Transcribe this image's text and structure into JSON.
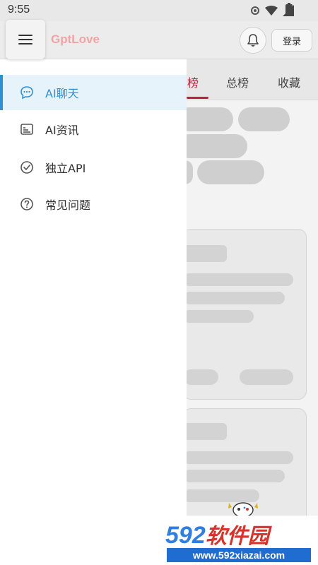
{
  "status_bar": {
    "time": "9:55"
  },
  "header": {
    "app_title": "GptLove",
    "login_label": "登录"
  },
  "tabs": [
    {
      "label": "榜",
      "active": true
    },
    {
      "label": "总榜",
      "active": false
    },
    {
      "label": "收藏",
      "active": false
    }
  ],
  "drawer": {
    "items": [
      {
        "label": "AI聊天",
        "icon": "chat-bubble-icon",
        "active": true
      },
      {
        "label": "AI资讯",
        "icon": "news-card-icon",
        "active": false
      },
      {
        "label": "独立API",
        "icon": "check-circle-icon",
        "active": false
      },
      {
        "label": "常见问题",
        "icon": "help-circle-icon",
        "active": false
      }
    ]
  },
  "watermark": {
    "logo_number": "592",
    "logo_text": "软件园",
    "url": "www.592xiazai.com"
  },
  "colors": {
    "accent": "#2f8fd6",
    "tab_accent": "#c2203f",
    "title": "#f2a3a3"
  }
}
